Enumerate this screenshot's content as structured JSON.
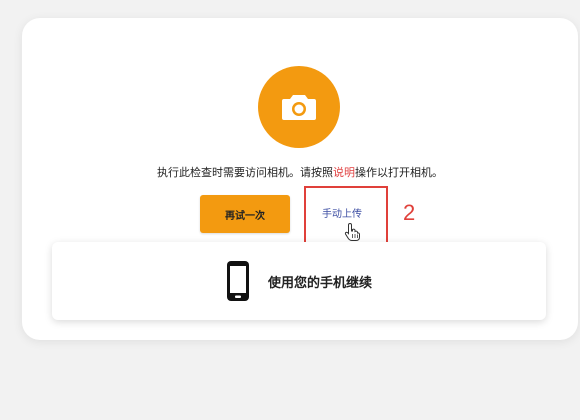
{
  "instruction": {
    "before": "执行此检查时需要访问相机。请按照",
    "link": "说明",
    "after": "操作以打开相机。"
  },
  "buttons": {
    "retry_label": "再试一次",
    "manual_upload_label": "手动上传"
  },
  "phone_option": {
    "label": "使用您的手机继续"
  },
  "annotation": {
    "number": "2"
  },
  "colors": {
    "accent": "#f39a10",
    "link": "#e04040",
    "manual_upload": "#3d4ea3",
    "highlight": "#e0403a"
  },
  "icons": {
    "camera": "camera-icon",
    "phone": "phone-icon",
    "cursor": "hand-cursor-icon"
  }
}
